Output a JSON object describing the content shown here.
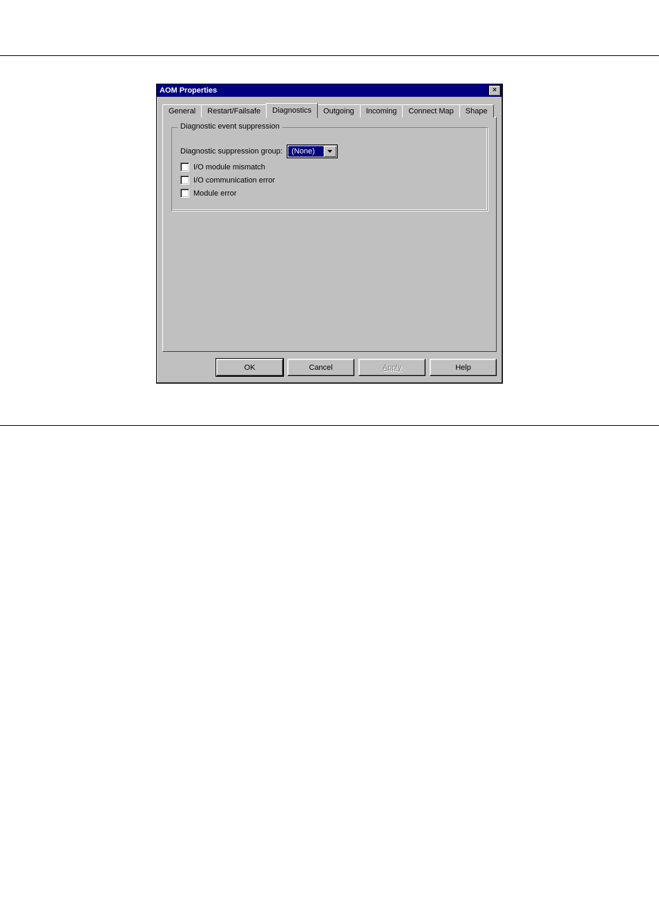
{
  "dialog": {
    "title": "AOM Properties",
    "close_icon": "×"
  },
  "tabs": {
    "general": "General",
    "restart_failsafe": "Restart/Failsafe",
    "diagnostics": "Diagnostics",
    "outgoing": "Outgoing",
    "incoming": "Incoming",
    "connect_map": "Connect Map",
    "shape": "Shape"
  },
  "groupbox": {
    "legend": "Diagnostic event suppression",
    "suppression_label": "Diagnostic suppression group:",
    "suppression_value": "(None)",
    "checkbox_mismatch": "I/O module mismatch",
    "checkbox_comm_error": "I/O communication error",
    "checkbox_module_error": "Module error"
  },
  "buttons": {
    "ok": "OK",
    "cancel": "Cancel",
    "apply": "Apply",
    "help": "Help"
  }
}
